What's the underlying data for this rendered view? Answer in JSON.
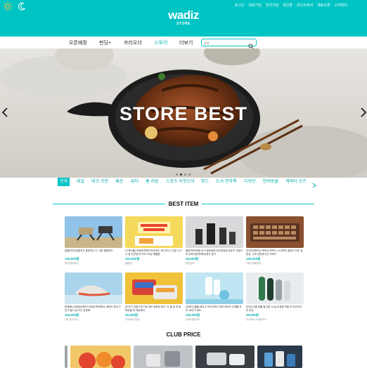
{
  "header": {
    "top_links": [
      "로그인",
      "회원가입",
      "전국가입",
      "월간론",
      "와디즈에서",
      "매표오류",
      "고객센터"
    ],
    "logo_name": "wadiz",
    "logo_sub": "STORE",
    "icons": [
      "sun-icon",
      "moon-icon"
    ]
  },
  "nav": {
    "items": [
      "오픈예정",
      "펀딩+",
      "프리오더",
      "스토어",
      "더보기"
    ],
    "active": "스토어",
    "search_placeholder": "검색"
  },
  "hero": {
    "title": "STORE BEST",
    "slide_count": 4,
    "active_slide": 2
  },
  "categories": {
    "items": [
      "전체",
      "테일",
      "테크·가전",
      "패션",
      "뷰티",
      "홈·리빙",
      "스포츠·아웃도어",
      "푸드",
      "도서·전자책",
      "디자인",
      "반려동물",
      "캐릭터·굿즈"
    ],
    "active": "전체"
  },
  "best_item": {
    "title": "BEST ITEM",
    "products": [
      {
        "desc": "[캠핑의자] 캠핑지도 용한먹는 다 고충 캠핑체어",
        "price": "129,000원",
        "maker": "아이엠어워커"
      },
      {
        "desc": "[그레이몰] 미대의관예작 미대자운 1위 하이그 리몬 누구나 쉽 인연생 반 PDF+리유 행몰원",
        "price": "219,000원",
        "maker": "클래임"
      },
      {
        "desc": "[탈모케어전문] 바구 탈모점만이야 헌정유리성 투 관절키마 주마속(탄력헤어)현관 잡이",
        "price": "29,500원",
        "maker": "탄탄상자"
      },
      {
        "desc": "[초간단예보드] 목조의 키보드 | 소리꽉차 클레식 타건 딜 맞은, 기모 남편에 무선 키보드",
        "price": "129,000원",
        "maker": "1위기계획위이"
      },
      {
        "desc": "[운동화] 1위한답게하어 운경도목력에서, 패락도 특산기단고 발이 슬 이는 운동화",
        "price": "119,000원",
        "maker": "1위 잎드상사"
      },
      {
        "desc": "[도자기그릇] 도자기로 만든 컴파운 용기, 이 클 검 계 컴파운을 부 작은레비",
        "price": "25,000원",
        "maker": "우시회사 한공"
      },
      {
        "desc": "[선배기] 물물 쉐이고 보드리의안 워치 데이터 관세할 보리 사례 기 세트",
        "price": "119,000원",
        "maker": "1위오글러지스"
      },
      {
        "desc": "[우산] 아울 위를 필수름, 111g 초경량 작품 저 외산자이만 우산",
        "price": "29,000원",
        "maker": "우시회사 노엄비즈스"
      }
    ]
  },
  "club_price": {
    "title": "CLUB PRICE"
  },
  "colors": {
    "brand": "#00c4c4",
    "brand_text": "#00b0b0"
  }
}
